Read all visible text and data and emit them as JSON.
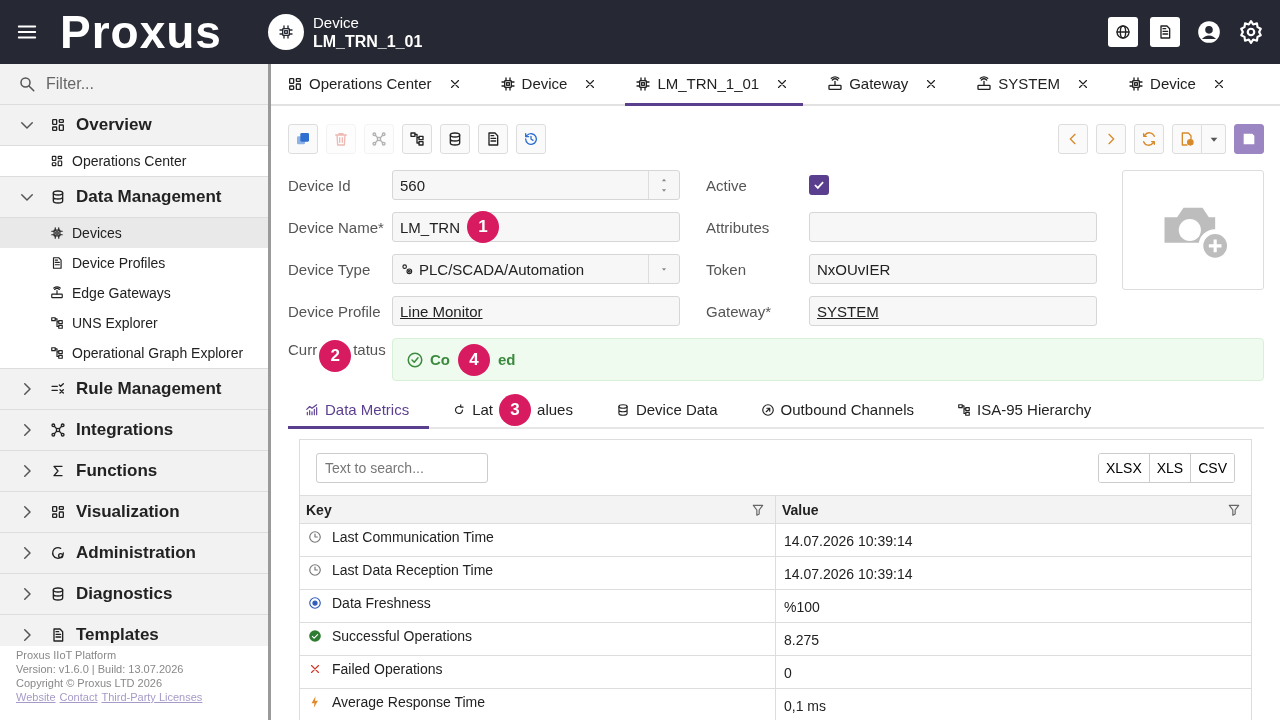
{
  "header": {
    "logo": "Proxus",
    "context": {
      "label": "Device",
      "name": "LM_TRN_1_01"
    }
  },
  "sidebar": {
    "filter_placeholder": "Filter...",
    "groups": [
      {
        "label": "Overview",
        "expanded": true,
        "children": [
          {
            "label": "Operations Center",
            "selected": false
          }
        ]
      },
      {
        "label": "Data Management",
        "expanded": true,
        "children": [
          {
            "label": "Devices",
            "selected": true
          },
          {
            "label": "Device Profiles",
            "selected": false
          },
          {
            "label": "Edge Gateways",
            "selected": false
          },
          {
            "label": "UNS Explorer",
            "selected": false
          },
          {
            "label": "Operational Graph Explorer",
            "selected": false
          }
        ]
      },
      {
        "label": "Rule Management",
        "expanded": false
      },
      {
        "label": "Integrations",
        "expanded": false
      },
      {
        "label": "Functions",
        "expanded": false
      },
      {
        "label": "Visualization",
        "expanded": false
      },
      {
        "label": "Administration",
        "expanded": false
      },
      {
        "label": "Diagnostics",
        "expanded": false
      },
      {
        "label": "Templates",
        "expanded": false
      }
    ],
    "footer": {
      "lines": [
        "Proxus IIoT Platform",
        "Version: v1.6.0 | Build: 13.07.2026",
        "Copyright © Proxus LTD 2026"
      ],
      "links": [
        "Website",
        "Contact",
        "Third-Party Licenses"
      ]
    }
  },
  "tabs": [
    {
      "label": "Operations Center",
      "selected": false
    },
    {
      "label": "Device",
      "selected": false
    },
    {
      "label": "LM_TRN_1_01",
      "selected": true
    },
    {
      "label": "Gateway",
      "selected": false
    },
    {
      "label": "SYSTEM",
      "selected": false
    },
    {
      "label": "Device",
      "selected": false
    }
  ],
  "toolbar": {
    "left": [
      {
        "disabled": false
      },
      {
        "disabled": true
      },
      {
        "disabled": true
      },
      {
        "disabled": false
      },
      {
        "disabled": false
      },
      {
        "disabled": false
      },
      {
        "disabled": false
      }
    ]
  },
  "form": {
    "left": [
      {
        "label": "Device Id",
        "kind": "number",
        "value": "560"
      },
      {
        "label": "Device Name*",
        "kind": "text",
        "value_parts": [
          "LM_TRN"
        ],
        "callout": "1"
      },
      {
        "label": "Device Type",
        "kind": "select",
        "value": "PLC/SCADA/Automation"
      },
      {
        "label": "Device Profile",
        "kind": "link",
        "value": "Line Monitor"
      }
    ],
    "right": [
      {
        "label": "Active",
        "kind": "checkbox",
        "checked": true
      },
      {
        "label": "Attributes",
        "kind": "text"
      },
      {
        "label": "Token",
        "kind": "text",
        "value": "NxOUvIER"
      },
      {
        "label": "Gateway*",
        "kind": "link",
        "value": "SYSTEM"
      }
    ],
    "status": {
      "label_parts": [
        "Curr",
        "tatus"
      ],
      "label_callout": "2",
      "value_parts": [
        "Co",
        "ed"
      ],
      "value_callout": "4",
      "kind": "success"
    }
  },
  "subtabs": [
    {
      "label": "Data Metrics",
      "selected": true
    },
    {
      "label_parts": [
        "Lat",
        "alues"
      ],
      "callout": "3",
      "selected": false
    },
    {
      "label": "Device Data",
      "selected": false
    },
    {
      "label": "Outbound Channels",
      "selected": false
    },
    {
      "label": "ISA-95 Hierarchy",
      "selected": false
    }
  ],
  "grid": {
    "search_placeholder": "Text to search...",
    "exports": [
      "XLSX",
      "XLS",
      "CSV"
    ],
    "columns": [
      "Key",
      "Value"
    ],
    "rows": [
      {
        "key": "Last Communication Time",
        "value": "14.07.2026 10:39:14"
      },
      {
        "key": "Last Data Reception Time",
        "value": "14.07.2026 10:39:14"
      },
      {
        "key": "Data Freshness",
        "value": "%100"
      },
      {
        "key": "Successful Operations",
        "value": "8.275"
      },
      {
        "key": "Failed Operations",
        "value": "0"
      },
      {
        "key": "Average Response Time",
        "value": "0,1 ms"
      }
    ]
  }
}
